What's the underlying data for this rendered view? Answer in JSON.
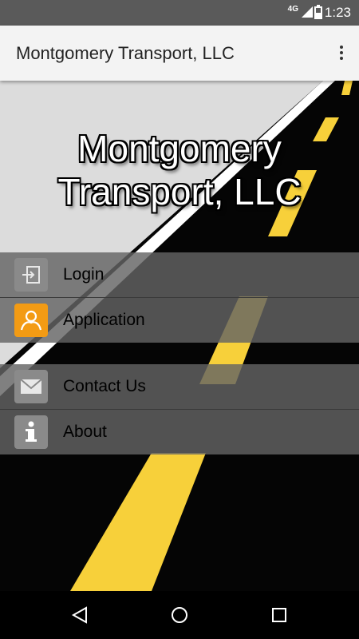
{
  "status_bar": {
    "network": "4G",
    "time": "1:23"
  },
  "app_bar": {
    "title": "Montgomery Transport, LLC"
  },
  "hero": {
    "title_line1": "Montgomery",
    "title_line2": "Transport, LLC"
  },
  "menu": {
    "items": [
      {
        "label": "Login",
        "icon": "login-icon"
      },
      {
        "label": "Application",
        "icon": "person-icon"
      },
      {
        "label": "Contact Us",
        "icon": "envelope-icon"
      },
      {
        "label": "About",
        "icon": "info-icon"
      }
    ]
  },
  "colors": {
    "road_yellow": "#f7d03a",
    "application_accent": "#f39b14",
    "status_bar": "#5a5a5a",
    "app_bar": "#f3f3f3"
  }
}
